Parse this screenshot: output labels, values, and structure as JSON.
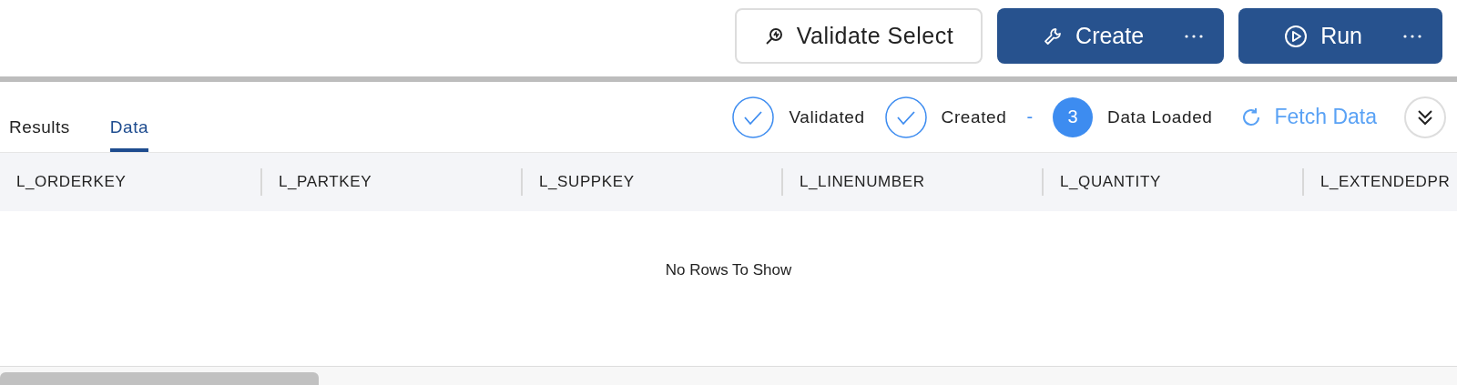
{
  "toolbar": {
    "buttons": [
      {
        "label": "Validate Select",
        "kind": "validate"
      },
      {
        "label": "Create",
        "kind": "create"
      },
      {
        "label": "Run",
        "kind": "run"
      }
    ]
  },
  "tabs": [
    {
      "label": "Results",
      "selected": false
    },
    {
      "label": "Data",
      "selected": true
    }
  ],
  "steps": [
    {
      "label": "Validated",
      "kind": "done"
    },
    {
      "label": "Created",
      "kind": "done"
    },
    {
      "label": "Data Loaded",
      "kind": "current",
      "number": "3",
      "separator": "-"
    }
  ],
  "fetch": {
    "label": "Fetch Data"
  },
  "table": {
    "columns": [
      "L_ORDERKEY",
      "L_PARTKEY",
      "L_SUPPKEY",
      "L_LINENUMBER",
      "L_QUANTITY",
      "L_EXTENDEDPR"
    ],
    "empty_message": "No Rows To Show"
  }
}
